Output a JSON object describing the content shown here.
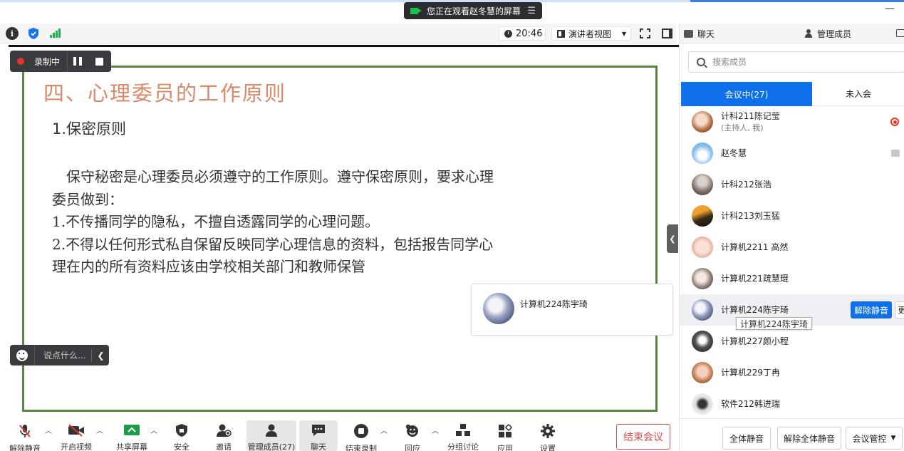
{
  "window": {
    "share_notice": "您正在观看赵冬慧的屏幕",
    "minimize": "—"
  },
  "meeting_bar": {
    "time": "20:46",
    "view_mode": "演讲者视图"
  },
  "recording": {
    "status": "录制中"
  },
  "reaction": {
    "placeholder": "说点什么..."
  },
  "slide": {
    "title": "四、心理委员的工作原则",
    "subtitle": "1.保密原则",
    "body_lines": [
      "　保守秘密是心理委员必须遵守的工作原则。遵守保密原则，要求心理",
      "委员做到：",
      "1.不传播同学的隐私，不擅自透露同学的心理问题。",
      "2.不得以任何形式私自保留反映同学心理信息的资料，包括报告同学心",
      "理在内的所有资料应该由学校相关部门和教师保管"
    ]
  },
  "active_speaker": {
    "name": "计算机224陈宇琦"
  },
  "toolbar": {
    "items": [
      {
        "label": "解除静音",
        "icon": "mic-muted-icon"
      },
      {
        "label": "开启视频",
        "icon": "video-off-icon"
      },
      {
        "label": "共享屏幕",
        "icon": "share-screen-icon"
      },
      {
        "label": "安全",
        "icon": "shield-icon"
      },
      {
        "label": "邀请",
        "icon": "invite-icon"
      },
      {
        "label": "管理成员(27)",
        "icon": "manage-members-icon"
      },
      {
        "label": "聊天",
        "icon": "chat-icon"
      },
      {
        "label": "结束录制",
        "icon": "stop-record-icon"
      },
      {
        "label": "回应",
        "icon": "reaction-icon"
      },
      {
        "label": "分组讨论",
        "icon": "breakout-icon"
      },
      {
        "label": "应用",
        "icon": "apps-icon"
      },
      {
        "label": "设置",
        "icon": "settings-icon"
      }
    ],
    "end_meeting": "结束会议"
  },
  "panel": {
    "tab_chat": "聊天",
    "tab_members": "管理成员",
    "search_placeholder": "搜索成员",
    "tab_in_meeting": "会议中(27)",
    "tab_not_joined": "未入会",
    "members": [
      {
        "name": "计科211陈记莹",
        "sub": "(主持人, 我)"
      },
      {
        "name": "赵冬慧",
        "sub": ""
      },
      {
        "name": "计科212张浩",
        "sub": ""
      },
      {
        "name": "计科213刘玉猛",
        "sub": ""
      },
      {
        "name": "计算机2211 高然",
        "sub": ""
      },
      {
        "name": "计算机221疏慧琨",
        "sub": ""
      },
      {
        "name": "计算机224陈宇琦",
        "sub": ""
      },
      {
        "name": "计算机227颜小程",
        "sub": ""
      },
      {
        "name": "计算机229丁冉",
        "sub": ""
      },
      {
        "name": "软件212韩进瑞",
        "sub": ""
      }
    ],
    "unmute_button": "解除静音",
    "tooltip": "计算机224陈宇琦",
    "footer": {
      "mute_all": "全体静音",
      "unmute_all": "解除全体静音",
      "control": "会议管控"
    }
  },
  "colors": {
    "accent_blue": "#0e71eb",
    "record_red": "#e4342b",
    "slide_border": "#5b8440",
    "slide_title": "#d9886a"
  }
}
